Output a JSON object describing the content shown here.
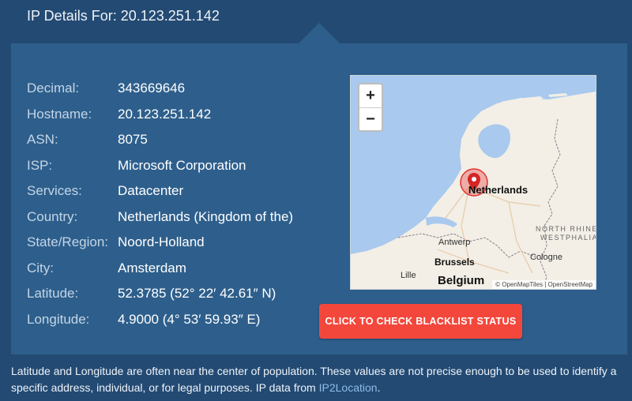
{
  "header": {
    "title": "IP Details For: 20.123.251.142"
  },
  "details": [
    {
      "label": "Decimal:",
      "value": "343669646"
    },
    {
      "label": "Hostname:",
      "value": "20.123.251.142"
    },
    {
      "label": "ASN:",
      "value": "8075"
    },
    {
      "label": "ISP:",
      "value": "Microsoft Corporation"
    },
    {
      "label": "Services:",
      "value": "Datacenter"
    },
    {
      "label": "Country:",
      "value": "Netherlands (Kingdom of the)"
    },
    {
      "label": "State/Region:",
      "value": "Noord-Holland"
    },
    {
      "label": "City:",
      "value": "Amsterdam"
    },
    {
      "label": "Latitude:",
      "value": "52.3785 (52° 22′ 42.61″ N)"
    },
    {
      "label": "Longitude:",
      "value": "4.9000 (4° 53′ 59.93″ E)"
    }
  ],
  "map": {
    "zoom_in": "+",
    "zoom_out": "−",
    "labels": {
      "netherlands": "Netherlands",
      "antwerp": "Antwerp",
      "brussels": "Brussels",
      "lille": "Lille",
      "cologne": "Cologne",
      "belgium": "Belgium",
      "north_rhine": "NORTH RHINE",
      "westphalia": "WESTPHALIA"
    },
    "attribution": "© OpenMapTiles | OpenStreetMap",
    "colors": {
      "water": "#a9c9ee",
      "land": "#f3efe6",
      "marker": "#e3312f"
    }
  },
  "blacklist_button": {
    "label": "CLICK TO CHECK BLACKLIST STATUS"
  },
  "footer": {
    "text": "Latitude and Longitude are often near the center of population. These values are not precise enough to be used to identify a specific address, individual, or for legal purposes. IP data from ",
    "link": "IP2Location",
    "end": "."
  }
}
